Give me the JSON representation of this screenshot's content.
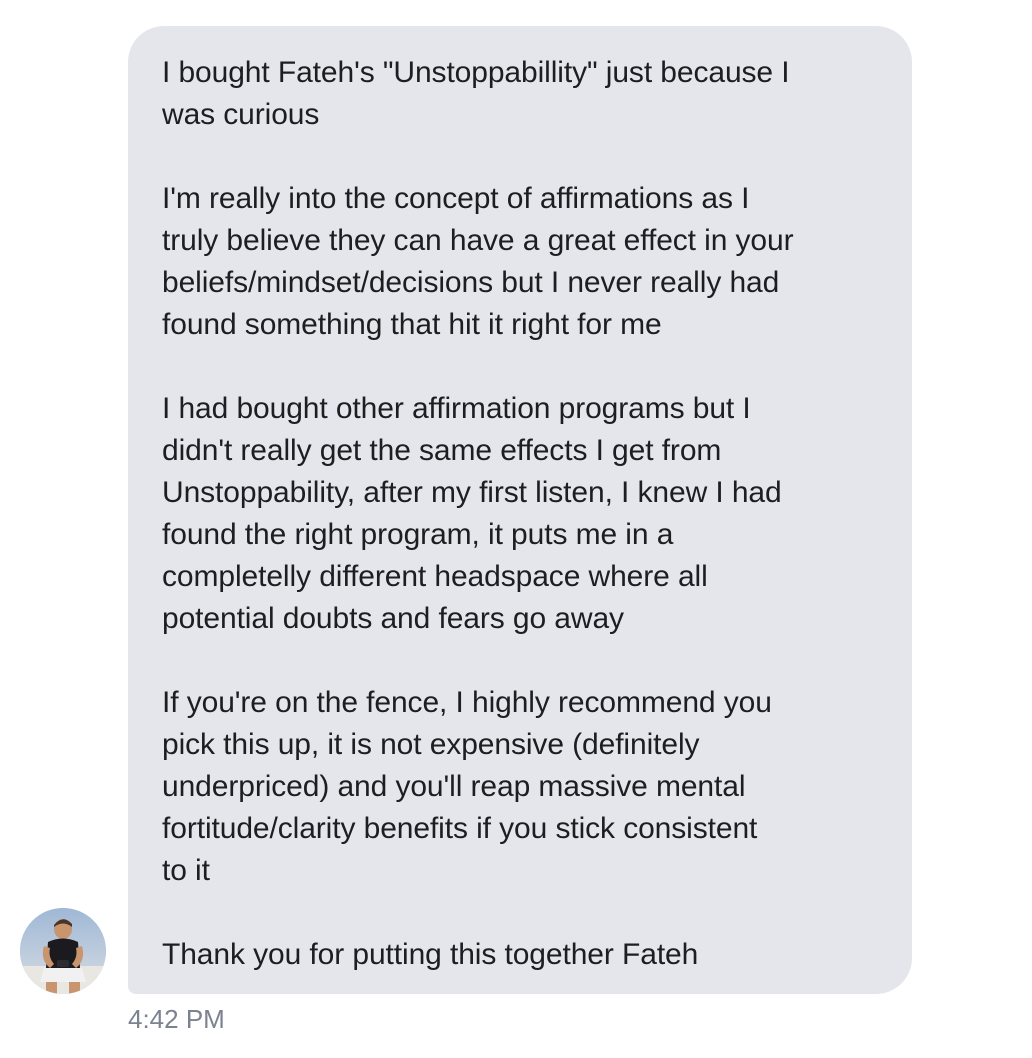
{
  "message": {
    "paragraphs": [
      {
        "lines": [
          "I bought Fateh's \"Unstoppabillity\" just because I",
          "was curious"
        ]
      },
      {
        "lines": [
          "I'm really into the concept of affirmations as I",
          "truly believe they can have a great effect in your",
          "beliefs/mindset/decisions but I never really had",
          "found something that hit it right for me"
        ]
      },
      {
        "lines": [
          "I had bought other affirmation programs but I",
          "didn't really get the same effects I get from",
          "Unstoppability, after my first listen, I knew I had",
          "found the right program, it puts me in a",
          "completelly different headspace where all",
          "potential doubts and fears go away"
        ]
      },
      {
        "lines": [
          "If you're on the fence, I highly recommend you",
          "pick this up, it is not expensive (definitely",
          "underpriced) and you'll reap massive mental",
          "fortitude/clarity benefits if you stick consistent",
          "to it"
        ]
      },
      {
        "lines": [
          "Thank you for putting this together Fateh"
        ]
      }
    ],
    "timestamp": "4:42 PM",
    "avatar_icon": "user-avatar-photo"
  },
  "colors": {
    "bubble_background": "#e4e6eb",
    "message_text": "#1c1e21",
    "timestamp_text": "#7b8290"
  }
}
